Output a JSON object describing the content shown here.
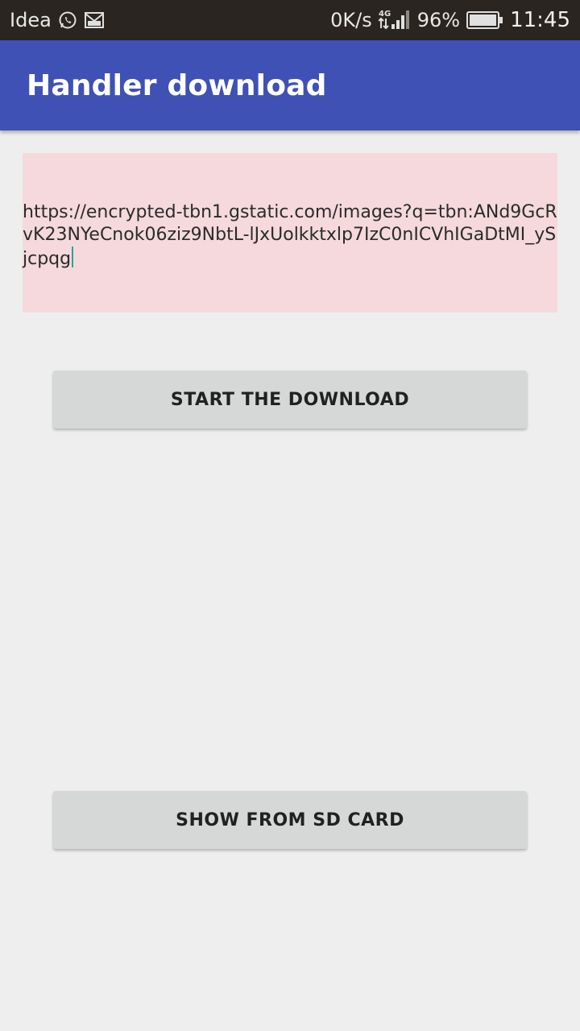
{
  "status_bar": {
    "carrier": "Idea",
    "net_speed": "0K/s",
    "network_type": "4G",
    "battery": "96%",
    "time": "11:45",
    "icons": [
      "whatsapp-icon",
      "gmail-icon",
      "signal-icon",
      "battery-icon"
    ]
  },
  "app_bar": {
    "title": "Handler download",
    "color": "#3f51b5"
  },
  "url_input": {
    "value": "https://encrypted-tbn1.gstatic.com/images?q=tbn:ANd9GcRvK23NYeCnok06ziz9NbtL-lJxUolkktxlp7IzC0nICVhIGaDtMI_ySjcpqg",
    "background": "#f5d9dc"
  },
  "buttons": {
    "start_download": "START THE DOWNLOAD",
    "show_sd_card": "SHOW FROM SD CARD"
  }
}
